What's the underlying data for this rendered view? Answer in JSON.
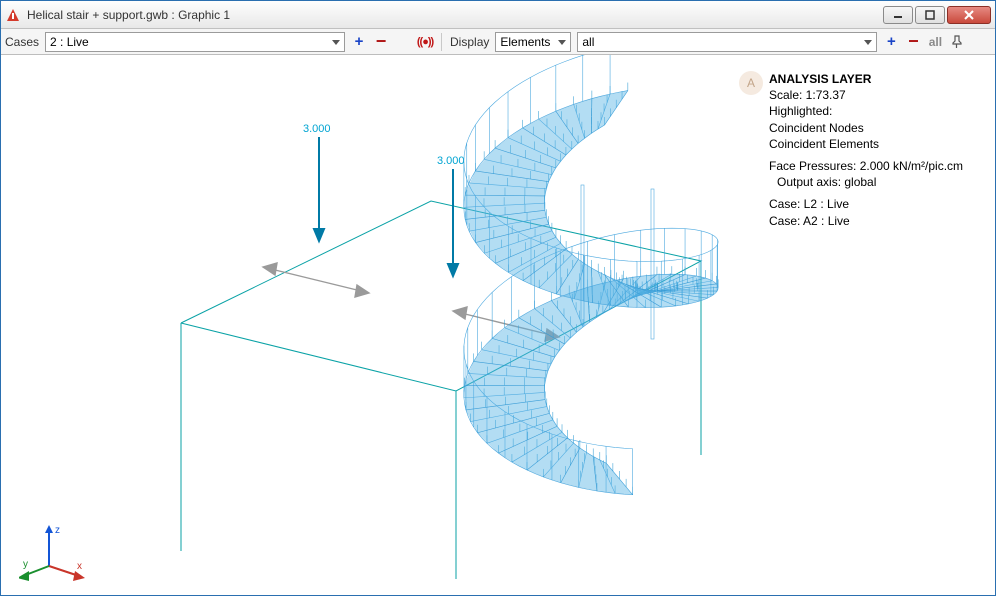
{
  "window": {
    "title": "Helical stair + support.gwb : Graphic 1"
  },
  "toolbar": {
    "cases_label": "Cases",
    "cases_value": "2 : Live",
    "display_label": "Display",
    "display_value": "Elements",
    "filter_value": "all",
    "all_text": "all"
  },
  "loads": {
    "value1": "3.000",
    "value2": "3.000"
  },
  "legend": {
    "title": "ANALYSIS LAYER",
    "scale": "Scale: 1:73.37",
    "highlighted": "Highlighted:",
    "coincident_nodes": "Coincident Nodes",
    "coincident_elements": "Coincident Elements",
    "face_pressures": "Face Pressures: 2.000 kN/m²/pic.cm",
    "output_axis": "Output axis: global",
    "case_l2": "Case: L2 : Live",
    "case_a2": "Case: A2 : Live"
  },
  "triad": {
    "x": "x",
    "y": "y",
    "z": "z"
  },
  "badge": {
    "A": "A"
  }
}
